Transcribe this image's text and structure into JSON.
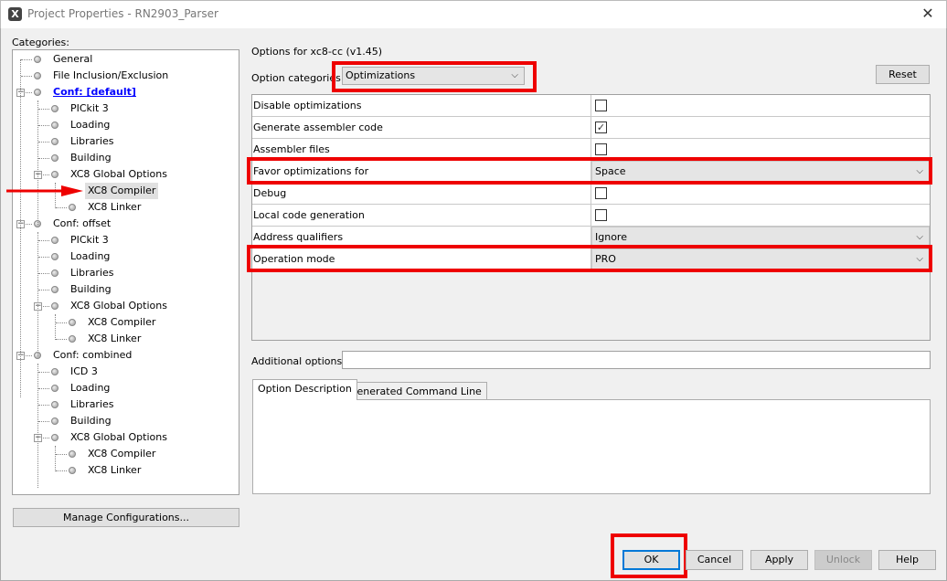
{
  "window": {
    "title": "Project Properties - RN2903_Parser",
    "close": "✕",
    "icon": "X"
  },
  "categories": {
    "label": "Categories:",
    "tree": [
      {
        "label": "General",
        "level": 0
      },
      {
        "label": "File Inclusion/Exclusion",
        "level": 0
      },
      {
        "label": "Conf: [default]",
        "level": 0,
        "expander": true,
        "link": true
      },
      {
        "label": "PICkit 3",
        "level": 1
      },
      {
        "label": "Loading",
        "level": 1
      },
      {
        "label": "Libraries",
        "level": 1
      },
      {
        "label": "Building",
        "level": 1
      },
      {
        "label": "XC8 Global Options",
        "level": 1,
        "expander": true
      },
      {
        "label": "XC8 Compiler",
        "level": 2,
        "selected": true
      },
      {
        "label": "XC8 Linker",
        "level": 2
      },
      {
        "label": "Conf: offset",
        "level": 0,
        "expander": true
      },
      {
        "label": "PICkit 3",
        "level": 1
      },
      {
        "label": "Loading",
        "level": 1
      },
      {
        "label": "Libraries",
        "level": 1
      },
      {
        "label": "Building",
        "level": 1
      },
      {
        "label": "XC8 Global Options",
        "level": 1,
        "expander": true
      },
      {
        "label": "XC8 Compiler",
        "level": 2
      },
      {
        "label": "XC8 Linker",
        "level": 2
      },
      {
        "label": "Conf: combined",
        "level": 0,
        "expander": true
      },
      {
        "label": "ICD 3",
        "level": 1
      },
      {
        "label": "Loading",
        "level": 1
      },
      {
        "label": "Libraries",
        "level": 1
      },
      {
        "label": "Building",
        "level": 1
      },
      {
        "label": "XC8 Global Options",
        "level": 1,
        "expander": true
      },
      {
        "label": "XC8 Compiler",
        "level": 2
      },
      {
        "label": "XC8 Linker",
        "level": 2
      }
    ],
    "manage": "Manage Configurations..."
  },
  "options": {
    "title": "Options for xc8-cc (v1.45)",
    "category_label": "Option categories:",
    "category_value": "Optimizations",
    "reset": "Reset",
    "rows": [
      {
        "name": "Disable optimizations",
        "type": "checkbox",
        "checked": false
      },
      {
        "name": "Generate assembler code",
        "type": "checkbox",
        "checked": true
      },
      {
        "name": "Assembler files",
        "type": "checkbox",
        "checked": false
      },
      {
        "name": "Favor optimizations for",
        "type": "select",
        "value": "Space",
        "highlight": true
      },
      {
        "name": "Debug",
        "type": "checkbox",
        "checked": false
      },
      {
        "name": "Local code generation",
        "type": "checkbox",
        "checked": false
      },
      {
        "name": "Address qualifiers",
        "type": "select",
        "value": "Ignore"
      },
      {
        "name": "Operation mode",
        "type": "select",
        "value": "PRO",
        "highlight": true
      }
    ],
    "additional_label": "Additional options:",
    "additional_value": "",
    "tabs": [
      "Option Description",
      "Generated Command Line"
    ]
  },
  "buttons": {
    "ok": "OK",
    "cancel": "Cancel",
    "apply": "Apply",
    "unlock": "Unlock",
    "help": "Help"
  },
  "colors": {
    "highlight": "#ee0000",
    "link": "#0000ff",
    "focus": "#0078d7"
  }
}
